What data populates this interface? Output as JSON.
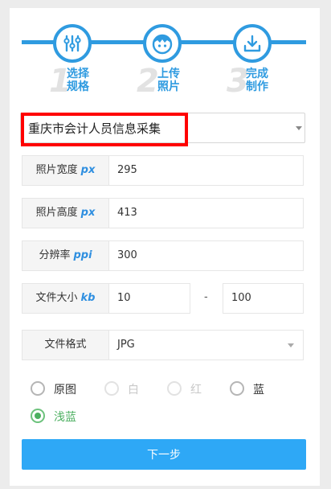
{
  "steps": [
    {
      "number": "1",
      "label_line1": "选择",
      "label_line2": "规格",
      "icon": "sliders-icon"
    },
    {
      "number": "2",
      "label_line1": "上传",
      "label_line2": "照片",
      "icon": "person-icon"
    },
    {
      "number": "3",
      "label_line1": "完成",
      "label_line2": "制作",
      "icon": "download-icon"
    }
  ],
  "template": {
    "selected": "重庆市会计人员信息采集"
  },
  "fields": {
    "width": {
      "label": "照片宽度",
      "unit": "px",
      "value": "295"
    },
    "height": {
      "label": "照片高度",
      "unit": "px",
      "value": "413"
    },
    "resolution": {
      "label": "分辨率",
      "unit": "ppi",
      "value": "300"
    },
    "filesize": {
      "label": "文件大小",
      "unit": "kb",
      "min": "10",
      "separator": "-",
      "max": "100"
    },
    "format": {
      "label": "文件格式",
      "value": "JPG"
    }
  },
  "background_options": [
    {
      "label": "原图",
      "state": "normal"
    },
    {
      "label": "白",
      "state": "disabled"
    },
    {
      "label": "红",
      "state": "disabled"
    },
    {
      "label": "蓝",
      "state": "normal"
    },
    {
      "label": "浅蓝",
      "state": "checked"
    }
  ],
  "next_button": {
    "label": "下一步"
  },
  "colors": {
    "accent": "#2f9be0",
    "button": "#2ea8f6",
    "highlight": "#ff0000",
    "selected_radio": "#4caf60"
  }
}
